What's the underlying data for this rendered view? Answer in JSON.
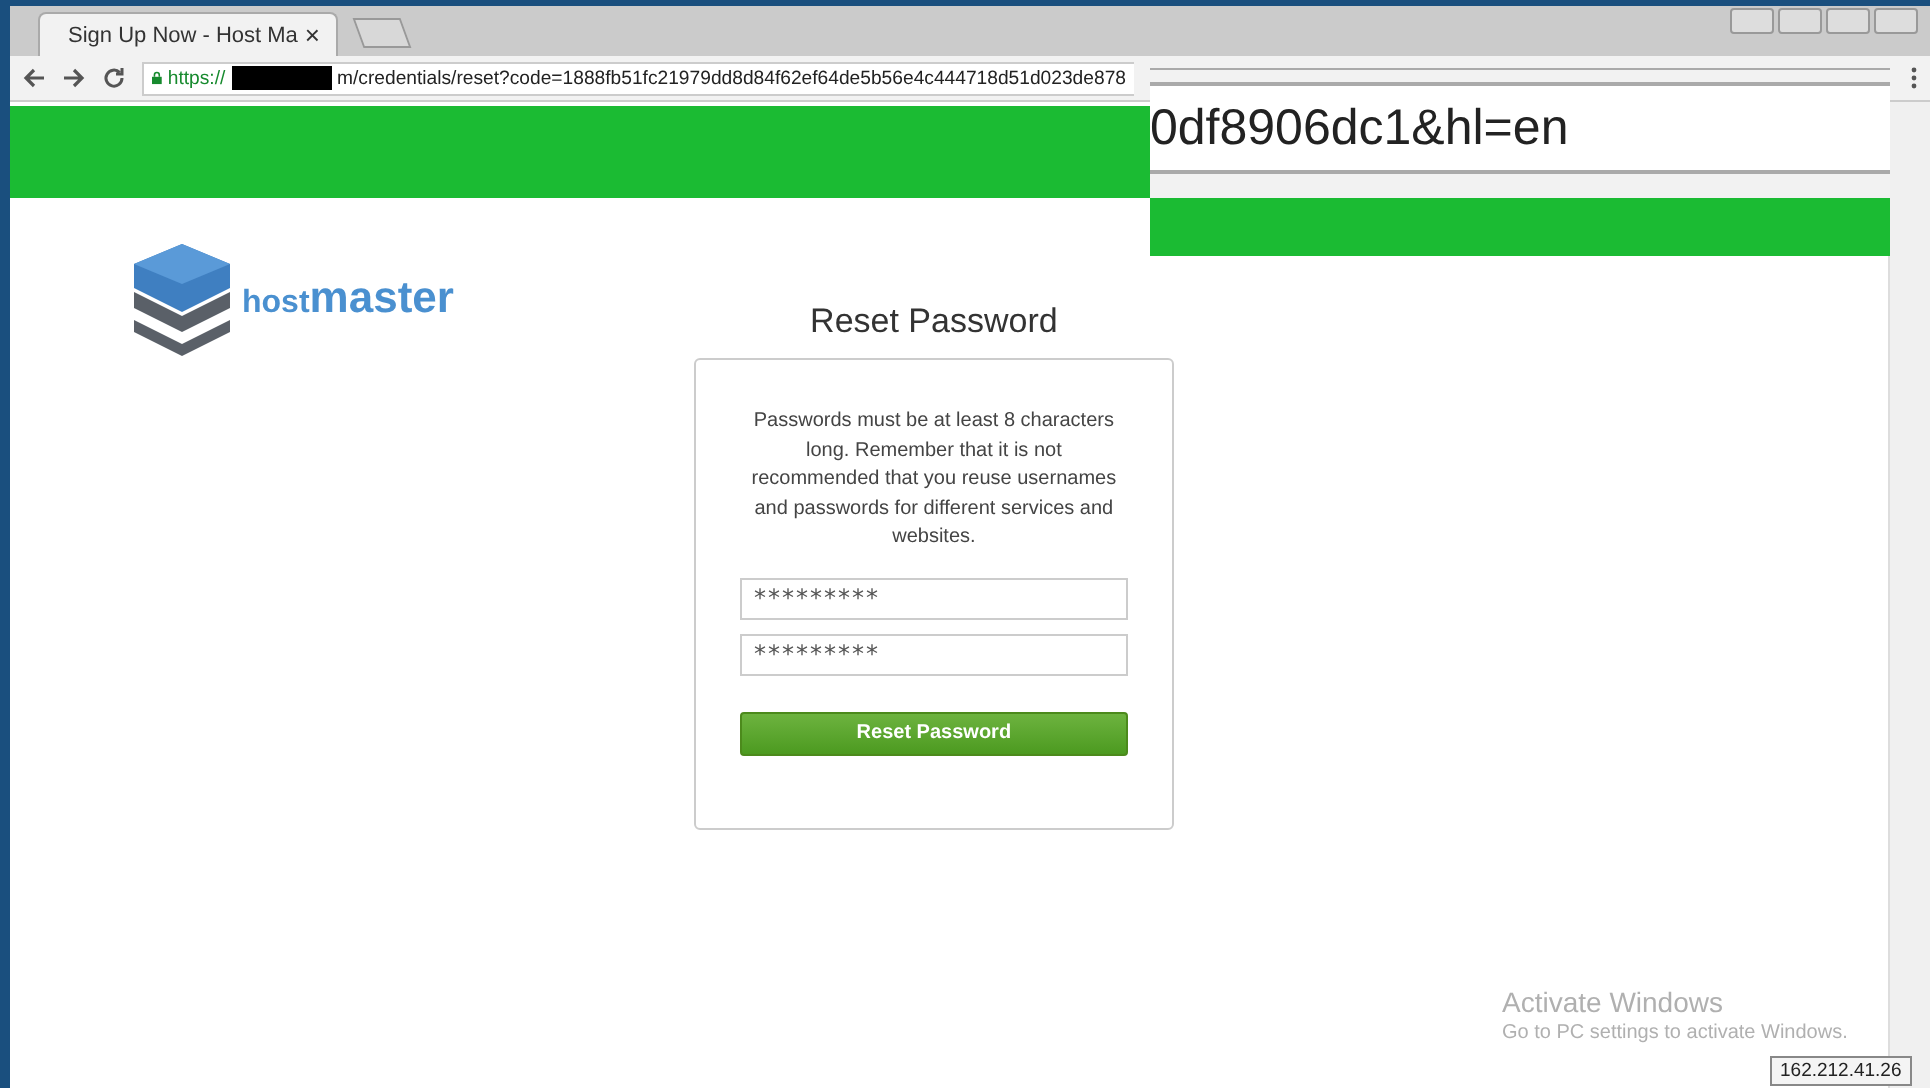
{
  "tab": {
    "title": "Sign Up Now - Host Ma",
    "close": "×"
  },
  "address_bar": {
    "scheme": "https://",
    "url": "m/credentials/reset?code=1888fb51fc21979dd8d84f62ef64de5b56e4c444718d51d023de878"
  },
  "zoom_inset": {
    "text": "0df8906dc1&hl=en"
  },
  "logo": {
    "prefix": "host",
    "name": "master"
  },
  "form": {
    "title": "Reset Password",
    "note": "Passwords must be at least 8 characters long. Remember that it is not recommended that you reuse usernames and passwords for different services and websites.",
    "fields": [
      {
        "value": "*********"
      },
      {
        "value": "*********"
      }
    ],
    "button": "Reset Password"
  },
  "overlay": {
    "title": "Activate Windows",
    "subtitle": "Go to PC settings to activate Windows."
  },
  "ip_label": "162.212.41.26"
}
